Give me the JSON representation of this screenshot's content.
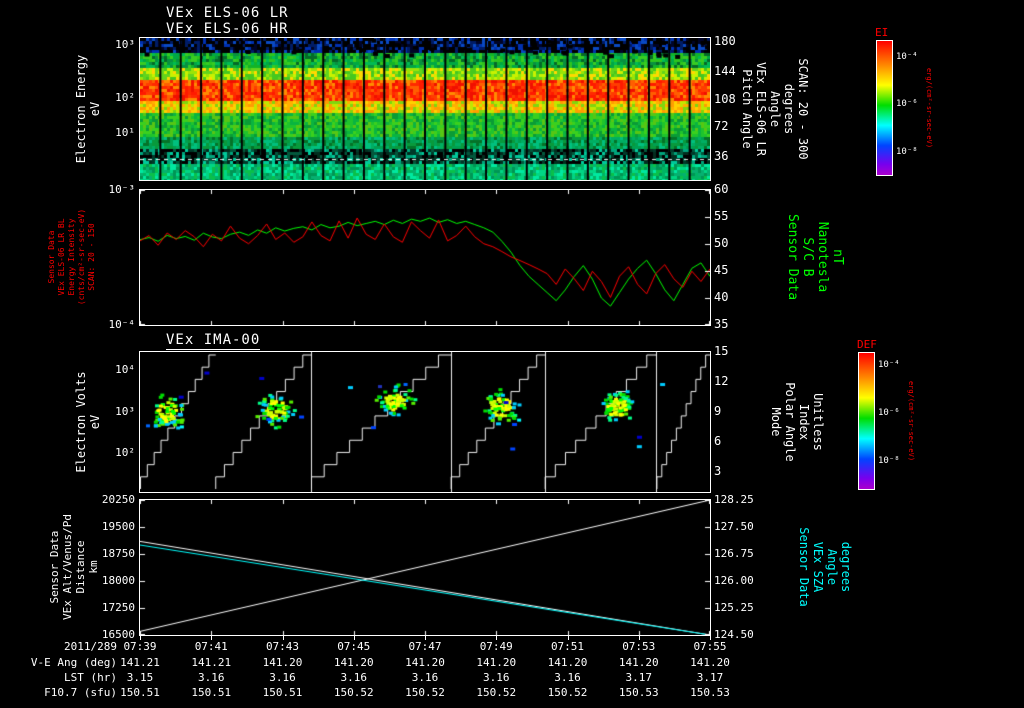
{
  "header": {
    "title_lr": "VEx ELS-06 LR",
    "title_hr": "VEx ELS-06 HR"
  },
  "colors": {
    "accent_red": "#ff0000",
    "accent_green": "#00ff00",
    "accent_cyan": "#00ffff",
    "white": "#ffffff",
    "background": "#000000"
  },
  "panels": {
    "els": {
      "left_label_lines": [
        "Electron Energy",
        "eV"
      ],
      "left_ticks": [
        {
          "label": "10³",
          "pos": 0.05
        },
        {
          "label": "10²",
          "pos": 0.42
        },
        {
          "label": "10¹",
          "pos": 0.67
        }
      ],
      "right_ticks": [
        {
          "label": "180",
          "pos": 0.03
        },
        {
          "label": "144",
          "pos": 0.24
        },
        {
          "label": "108",
          "pos": 0.44
        },
        {
          "label": "72",
          "pos": 0.63
        },
        {
          "label": "36",
          "pos": 0.84
        }
      ],
      "right_label_lines": [
        "Pitch Angle",
        "VEx ELS-06 LR",
        "Angle",
        "degrees",
        "SCAN: 20 - 300"
      ]
    },
    "line2": {
      "left_label_lines": [
        "Sensor Data",
        "VEx ELS-06 LR BL",
        "Energy Intensity",
        "(cnts/cm²-sr-sec-eV)",
        "SCAN: 20 - 150"
      ],
      "left_ticks": [
        {
          "label": "10⁻³",
          "pos": 0.0
        },
        {
          "label": "10⁻⁴",
          "pos": 1.0
        }
      ],
      "right_ticks": [
        {
          "label": "60",
          "pos": 0.0
        },
        {
          "label": "55",
          "pos": 0.2
        },
        {
          "label": "50",
          "pos": 0.4
        },
        {
          "label": "45",
          "pos": 0.6
        },
        {
          "label": "40",
          "pos": 0.8
        },
        {
          "label": "35",
          "pos": 1.0
        }
      ],
      "right_label_lines": [
        "Sensor Data",
        "S/C B",
        "Nanotesla",
        "nT"
      ]
    },
    "ima": {
      "title": "VEx IMA-00",
      "left_label_lines": [
        "Electron Volts",
        "eV"
      ],
      "left_ticks": [
        {
          "label": "10⁴",
          "pos": 0.13
        },
        {
          "label": "10³",
          "pos": 0.43
        },
        {
          "label": "10²",
          "pos": 0.72
        }
      ],
      "right_ticks": [
        {
          "label": "15",
          "pos": 0.0
        },
        {
          "label": "12",
          "pos": 0.214
        },
        {
          "label": "9",
          "pos": 0.429
        },
        {
          "label": "6",
          "pos": 0.643
        },
        {
          "label": "3",
          "pos": 0.857
        }
      ],
      "right_label_lines": [
        "Mode",
        "Polar Angle",
        "Index",
        "Unitless"
      ]
    },
    "alt": {
      "left_label_lines": [
        "Sensor Data",
        "VEx Alt/Venus/Pd",
        "Distance",
        "km"
      ],
      "left_ticks": [
        {
          "label": "20250",
          "pos": 0.0
        },
        {
          "label": "19500",
          "pos": 0.2
        },
        {
          "label": "18750",
          "pos": 0.4
        },
        {
          "label": "18000",
          "pos": 0.6
        },
        {
          "label": "17250",
          "pos": 0.8
        },
        {
          "label": "16500",
          "pos": 1.0
        }
      ],
      "right_ticks": [
        {
          "label": "128.25",
          "pos": 0.0
        },
        {
          "label": "127.50",
          "pos": 0.2
        },
        {
          "label": "126.75",
          "pos": 0.4
        },
        {
          "label": "126.00",
          "pos": 0.6
        },
        {
          "label": "125.25",
          "pos": 0.8
        },
        {
          "label": "124.50",
          "pos": 1.0
        }
      ],
      "right_label_lines": [
        "Sensor Data",
        "VEx SZA",
        "Angle",
        "degrees"
      ]
    }
  },
  "colorbars": [
    {
      "id": "ei",
      "title": "EI",
      "unit": "erg/(cm²-sr-sec-eV)",
      "ticks": [
        {
          "label": "10⁻⁴",
          "pos": 0.13
        },
        {
          "label": "10⁻⁶",
          "pos": 0.48
        },
        {
          "label": "10⁻⁸",
          "pos": 0.83
        }
      ]
    },
    {
      "id": "def",
      "title": "DEF",
      "unit": "erg/(cm²-sr-sec-eV)",
      "ticks": [
        {
          "label": "10⁻⁴",
          "pos": 0.1
        },
        {
          "label": "10⁻⁶",
          "pos": 0.45
        },
        {
          "label": "10⁻⁸",
          "pos": 0.8
        }
      ]
    }
  ],
  "time_axis": {
    "date": "2011/289",
    "ticks": [
      "07:39",
      "07:41",
      "07:43",
      "07:45",
      "07:47",
      "07:49",
      "07:51",
      "07:53",
      "07:55"
    ]
  },
  "bottom_rows": [
    {
      "label": "V-E Ang (deg)",
      "values": [
        "141.21",
        "141.21",
        "141.20",
        "141.20",
        "141.20",
        "141.20",
        "141.20",
        "141.20",
        "141.20"
      ]
    },
    {
      "label": "LST (hr)",
      "values": [
        "3.15",
        "3.16",
        "3.16",
        "3.16",
        "3.16",
        "3.16",
        "3.16",
        "3.17",
        "3.17"
      ]
    },
    {
      "label": "F10.7 (sfu)",
      "values": [
        "150.51",
        "150.51",
        "150.51",
        "150.52",
        "150.52",
        "150.52",
        "150.52",
        "150.53",
        "150.53"
      ]
    }
  ],
  "chart_data": [
    {
      "id": "els_spectrogram",
      "type": "heatmap",
      "title": "VEx ELS-06 LR/HR electron energy-time spectrogram",
      "x_range": [
        "07:39",
        "07:55"
      ],
      "ylabel": "Electron Energy (eV)",
      "ylim_log": [
        3,
        2000
      ],
      "zlabel": "EI erg/(cm²-sr-sec-eV)",
      "zlim_log": [
        1e-08,
        0.0001
      ],
      "description": "Intense red band near 100 eV across full interval; green flux above and below; dark/blue speckle above 1000 eV; dark band with teal speckle near lowest energies; ~28 vertical sweep gaps; white dashed line near bottom.",
      "render": {
        "seed": 42,
        "n_gaps": 28,
        "dashed_line_y": 0.855,
        "bands": [
          {
            "from": 0.0,
            "to": 0.1,
            "colors": [
              "#000000",
              "#000000",
              "#001c66",
              "#0030b0",
              "#000000",
              "#0a49c2",
              "#000428"
            ]
          },
          {
            "from": 0.1,
            "to": 0.2,
            "colors": [
              "#00a844",
              "#12b428",
              "#2ec41e",
              "#089040",
              "#00bb55",
              "#056a28",
              "#38cc22"
            ]
          },
          {
            "from": 0.2,
            "to": 0.28,
            "colors": [
              "#63d41c",
              "#9ae407",
              "#c8f200",
              "#46c81e",
              "#ffd800"
            ]
          },
          {
            "from": 0.28,
            "to": 0.43,
            "colors": [
              "#ff1a00",
              "#ff3c00",
              "#ff5e00",
              "#f01000",
              "#ff8a00",
              "#ff2a00"
            ]
          },
          {
            "from": 0.43,
            "to": 0.52,
            "colors": [
              "#ff9e00",
              "#ffd000",
              "#c2e600",
              "#7fd60e",
              "#ffb000"
            ]
          },
          {
            "from": 0.52,
            "to": 0.68,
            "colors": [
              "#1fc42c",
              "#0ab440",
              "#3bd01e",
              "#0a9c36",
              "#57c614"
            ]
          },
          {
            "from": 0.68,
            "to": 0.78,
            "colors": [
              "#089a3c",
              "#00ae62",
              "#00c07e",
              "#047328",
              "#00a050"
            ]
          },
          {
            "from": 0.78,
            "to": 0.88,
            "colors": [
              "#000000",
              "#022e1e",
              "#02583c",
              "#00a47c",
              "#000000",
              "#013a2a",
              "#00c89a"
            ]
          },
          {
            "from": 0.88,
            "to": 1.0,
            "colors": [
              "#00b464",
              "#00d684",
              "#0ac04a",
              "#009655",
              "#00e8a0",
              "#06b070"
            ]
          }
        ]
      }
    },
    {
      "id": "els_line",
      "type": "line",
      "x_range": [
        "07:39",
        "07:55"
      ],
      "ylim_left_log": [
        0.0001,
        0.001
      ],
      "ylim_right": [
        35,
        60
      ],
      "series": [
        {
          "name": "ELS Energy Intensity",
          "axis": "left",
          "units": "×10⁻⁴ (cnts/cm²-sr-sec-eV)",
          "color": "#ff0000",
          "values": [
            4.2,
            4.6,
            3.9,
            4.8,
            4.3,
            5.0,
            4.5,
            3.8,
            4.7,
            4.2,
            5.4,
            4.4,
            4.0,
            4.6,
            5.6,
            4.3,
            4.8,
            4.1,
            4.5,
            5.8,
            4.6,
            4.2,
            5.9,
            4.4,
            6.2,
            4.7,
            4.3,
            5.6,
            4.5,
            4.1,
            5.8,
            5.0,
            4.4,
            6.0,
            4.2,
            4.6,
            5.4,
            4.5,
            4.0,
            3.8,
            3.5,
            3.2,
            3.0,
            2.8,
            2.6,
            2.4,
            2.0,
            2.6,
            2.2,
            1.8,
            2.5,
            2.1,
            1.6,
            2.3,
            2.7,
            2.0,
            1.7,
            2.4,
            2.8,
            2.2,
            1.9,
            2.5,
            2.1,
            2.6
          ]
        },
        {
          "name": "S/C B",
          "axis": "right",
          "units": "nT",
          "color": "#00ff00",
          "values": [
            50.8,
            51.2,
            50.5,
            51.6,
            51.0,
            51.4,
            50.7,
            52.0,
            51.3,
            51.0,
            51.8,
            52.2,
            51.6,
            52.6,
            52.0,
            53.0,
            52.4,
            52.9,
            53.2,
            52.6,
            53.6,
            53.0,
            53.3,
            54.0,
            53.4,
            53.8,
            54.2,
            53.6,
            54.4,
            53.8,
            54.6,
            54.2,
            54.8,
            54.0,
            54.5,
            53.8,
            54.2,
            53.6,
            53.0,
            52.2,
            50.5,
            48.5,
            46.0,
            44.0,
            42.5,
            41.0,
            39.5,
            41.5,
            44.0,
            46.0,
            43.5,
            40.0,
            38.5,
            41.0,
            43.5,
            45.5,
            47.0,
            44.5,
            41.5,
            39.5,
            42.5,
            45.5,
            46.5,
            44.0
          ]
        }
      ]
    },
    {
      "id": "ima_spectrogram",
      "type": "heatmap",
      "title": "VEx IMA-00 ion energy-time spectrogram",
      "x_range": [
        "07:39",
        "07:55"
      ],
      "ylabel": "Electron Volts (eV)",
      "ylim_log": [
        100,
        30000
      ],
      "right_axis": "Mode / Polar Angle Index (Unitless, 3-15)",
      "description": "Mostly empty (black) with ~5 green/yellow ion flux clusters near 1000 eV, white sawtooth polar-angle staircase lines and white vertical mode boundaries.",
      "render": {
        "seed": 7,
        "segments": [
          [
            0.0,
            0.132
          ],
          [
            0.132,
            0.3
          ],
          [
            0.3,
            0.545
          ],
          [
            0.545,
            0.71
          ],
          [
            0.71,
            0.906
          ],
          [
            0.906,
            1.0
          ]
        ],
        "vlines": [
          0.3,
          0.545,
          0.71,
          0.906
        ],
        "blobs": [
          {
            "cx": 0.045,
            "cy": 0.42
          },
          {
            "cx": 0.235,
            "cy": 0.4
          },
          {
            "cx": 0.445,
            "cy": 0.35
          },
          {
            "cx": 0.63,
            "cy": 0.38
          },
          {
            "cx": 0.835,
            "cy": 0.38
          }
        ]
      }
    },
    {
      "id": "alt_sza",
      "type": "line",
      "x_range": [
        "07:39",
        "07:55"
      ],
      "ylim_left": [
        16500,
        20250
      ],
      "ylim_right": [
        124.5,
        128.25
      ],
      "series": [
        {
          "name": "VEx Alt/Venus/Pd Distance (descending)",
          "axis": "left",
          "units": "km",
          "color": "#ffffff",
          "values": [
            19100,
            16500
          ]
        },
        {
          "name": "VEx Alt/Venus/Pd Distance (ascending)",
          "axis": "left",
          "units": "km",
          "color": "#ffffff",
          "values": [
            16600,
            20250
          ]
        },
        {
          "name": "VEx SZA Angle",
          "axis": "right",
          "units": "degrees",
          "color": "#00ffff",
          "values": [
            127.0,
            124.5
          ]
        }
      ]
    }
  ]
}
